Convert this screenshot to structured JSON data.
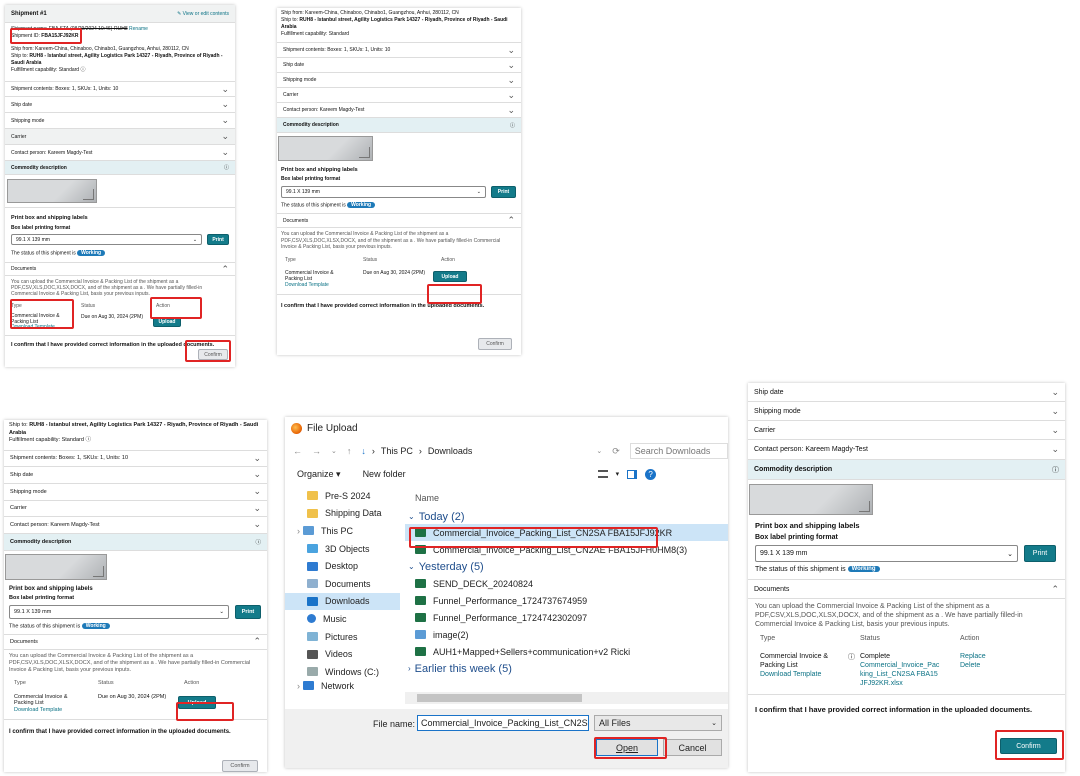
{
  "shipment": {
    "title": "Shipment #1",
    "view_edit": "View or edit contents",
    "name_line": "Shipment name: FBA STA (08/29/2024 19:46)-RUH8",
    "rename": "Rename",
    "id_label": "Shipment ID:",
    "id_value": "FBA15JFJ92KR",
    "ship_from": "Ship from: Kareem-China, Chinaboo, Chinabo1, Guangzhou, Anhui, 280112, CN",
    "ship_to_label": "Ship to:",
    "ship_to": "RUH8 - Istanbul street, Agility Logistics Park 14327 - Riyadh, Province of Riyadh - Saudi Arabia",
    "fulfillment": "Fulfillment capability: Standard",
    "contents": "Shipment contents: Boxes: 1, SKUs: 1, Units: 10",
    "ship_date": "Ship date",
    "shipping_mode": "Shipping mode",
    "carrier": "Carrier",
    "contact": "Contact person: Kareem Magdy-Test",
    "commodity": "Commodity description",
    "print_title": "Print box and shipping labels",
    "format_label": "Box label printing format",
    "format_value": "99.1 X 139 mm",
    "print_btn": "Print",
    "status_text": "The status of this shipment is",
    "status_badge": "Working",
    "documents": "Documents",
    "doc_info": "You can upload the Commercial Invoice & Packing List of the shipment as a PDF,CSV,XLS,DOC,XLSX,DOCX, and of the shipment as a . We have partially filled-in Commercial Invoice & Packing List, basis your previous inputs.",
    "col_type": "Type",
    "col_status": "Status",
    "col_action": "Action",
    "doc_name": "Commercial Invoice & Packing List",
    "download_template": "Download Template",
    "due": "Due on Aug 30, 2024 (2PM)",
    "upload_btn": "Upload",
    "confirm_text": "I confirm that I have provided correct information in the uploaded documents.",
    "confirm_btn": "Confirm"
  },
  "panel2": {
    "ship_from": "Ship from: Kareem-China, Chinaboo, Chinabo1, Guangzhou, Anhui, 280112, CN",
    "ship_to": "RUH8 - Istanbul street, Agility Logistics Park 14327 - Riyadh, Province of Riyadh - Saudi Arabia"
  },
  "panel3": {
    "ship_to": "RUH8 - Istanbul street, Agility Logistics Park 14327 - Riyadh, Province of Riyadh - Saudi Arabia"
  },
  "panel4": {
    "status_complete": "Complete",
    "file_link": "Commercial_Invoice_Packing_List_CN2SA FBA15JFJ92KR.xlsx",
    "replace": "Replace",
    "delete": "Delete"
  },
  "explorer": {
    "window_title": "File Upload",
    "path_pc": "This PC",
    "path_folder": "Downloads",
    "search_placeholder": "Search Downloads",
    "organize": "Organize",
    "new_folder": "New folder",
    "col_name": "Name",
    "tree": [
      "Pre-S 2024",
      "Shipping Data",
      "This PC",
      "3D Objects",
      "Desktop",
      "Documents",
      "Downloads",
      "Music",
      "Pictures",
      "Videos",
      "Windows (C:)",
      "Network"
    ],
    "group_today": "Today (2)",
    "group_yesterday": "Yesterday (5)",
    "group_earlier": "Earlier this week (5)",
    "files_today": [
      "Commercial_Invoice_Packing_List_CN2SA FBA15JFJ92KR",
      "Commercial_Invoice_Packing_List_CN2AE FBA15JFH0HM8(3)"
    ],
    "files_yesterday": [
      "SEND_DECK_20240824",
      "Funnel_Performance_1724737674959",
      "Funnel_Performance_1724742302097",
      "image(2)",
      "AUH1+Mapped+Sellers+communication+v2 Ricki"
    ],
    "file_name_label": "File name:",
    "file_name_value": "Commercial_Invoice_Packing_List_CN2S",
    "file_type": "All Files",
    "open_btn": "Open",
    "cancel_btn": "Cancel"
  }
}
